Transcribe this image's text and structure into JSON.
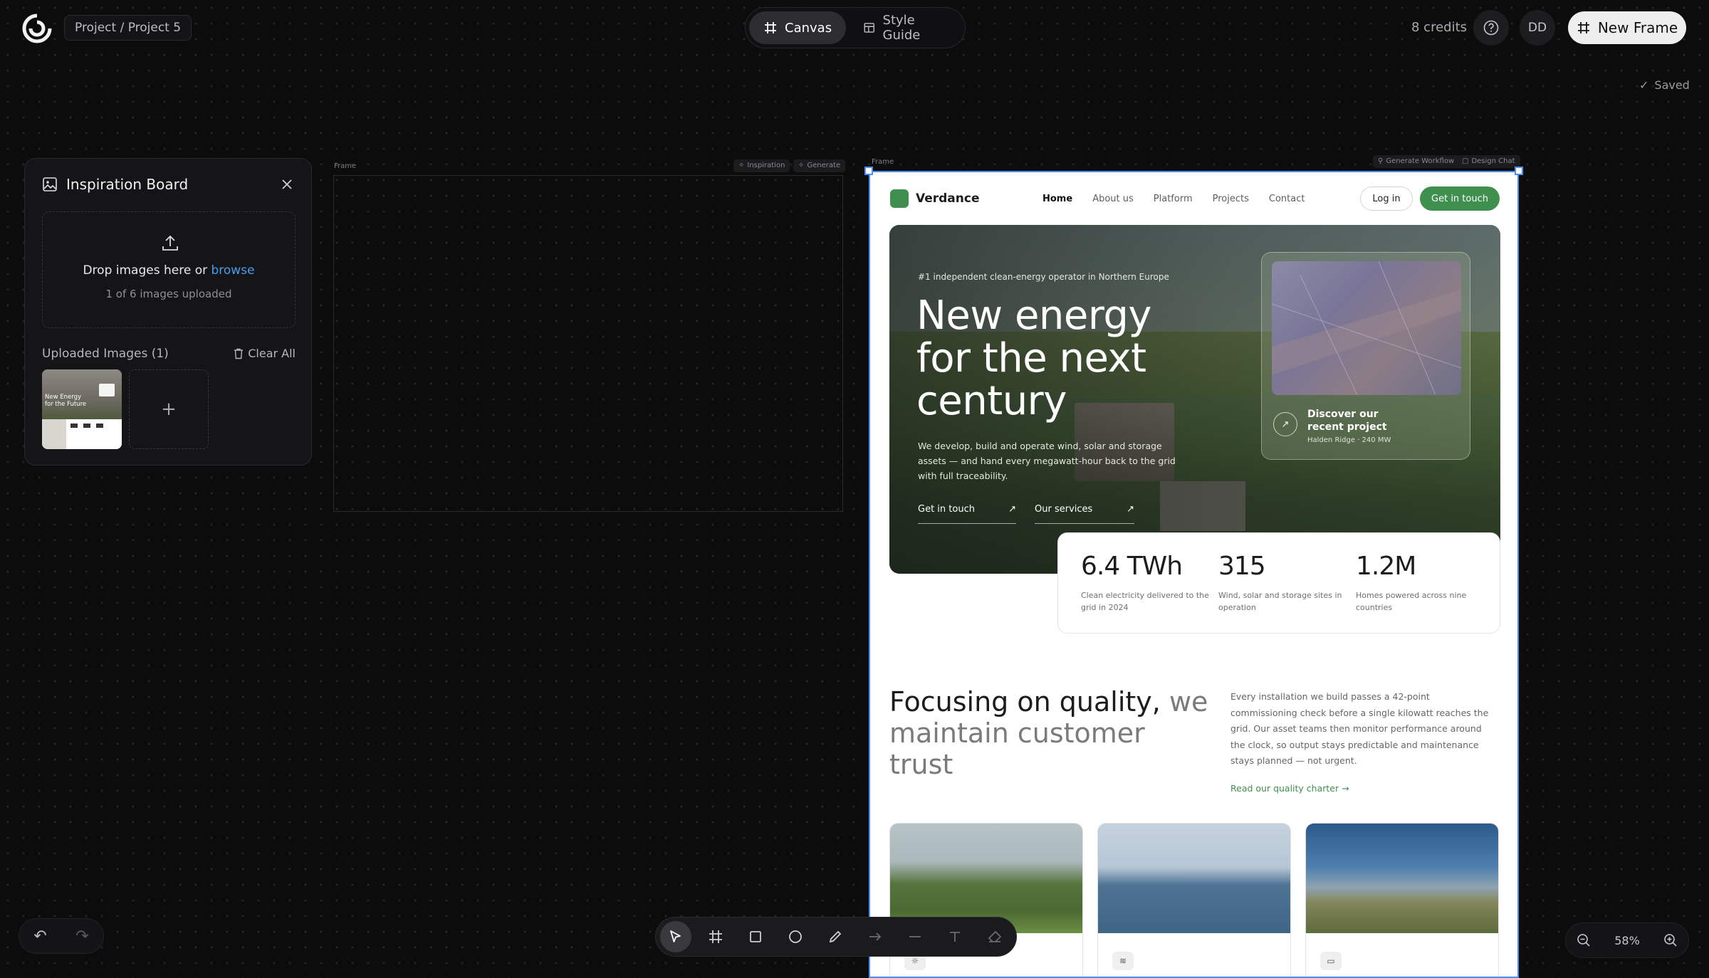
{
  "header": {
    "breadcrumb": "Project / Project 5",
    "tabs": [
      {
        "label": "Canvas",
        "icon": "frame-icon",
        "active": true
      },
      {
        "label": "Style Guide",
        "icon": "layout-icon",
        "active": false
      }
    ],
    "credits": "8 credits",
    "avatar_initials": "DD",
    "new_frame_label": "New Frame",
    "saved_label": "Saved"
  },
  "inspiration": {
    "title": "Inspiration Board",
    "drop_prefix": "Drop images here or ",
    "drop_link": "browse",
    "upload_count": "1 of 6 images uploaded",
    "uploaded_label": "Uploaded Images (1)",
    "clear_all": "Clear All",
    "add_symbol": "+",
    "thumb_caption": "New Energy for the Future"
  },
  "empty_frame": {
    "label": "Frame",
    "chips": [
      "Inspiration",
      "Generate"
    ]
  },
  "site_frame": {
    "label": "Frame",
    "chips": [
      "Generate Workflow",
      "Design Chat"
    ]
  },
  "site": {
    "brand": "Verdance",
    "nav": [
      "Home",
      "About us",
      "Platform",
      "Projects",
      "Contact"
    ],
    "login": "Log in",
    "cta": "Get in touch",
    "eyebrow": "#1 independent clean-energy operator in Northern Europe",
    "hero_title": "New energy for the next century",
    "hero_body": "We develop, build and operate wind, solar and storage assets — and hand every megawatt-hour back to the grid with full traceability.",
    "hero_links": [
      "Get in touch",
      "Our services"
    ],
    "project_title": "Discover our recent project",
    "project_sub": "Halden Ridge · 240 MW",
    "stats": [
      {
        "value": "6.4 TWh",
        "label": "Clean electricity delivered to the grid in 2024"
      },
      {
        "value": "315",
        "label": "Wind, solar and storage sites in operation"
      },
      {
        "value": "1.2M",
        "label": "Homes powered across nine countries"
      }
    ],
    "quality_title_strong": "Focusing on quality,",
    "quality_title_muted": " we maintain customer trust",
    "quality_body": "Every installation we build passes a 42-point commissioning check before a single kilowatt reaches the grid. Our asset teams then monitor performance around the clock, so output stays predictable and maintenance stays planned — not urgent.",
    "quality_link": "Read our quality charter →"
  },
  "zoom": {
    "level": "58%"
  },
  "colors": {
    "accent_green": "#3f8f4f",
    "selection_blue": "#4d8ff0",
    "link_blue": "#4c9cf0"
  }
}
